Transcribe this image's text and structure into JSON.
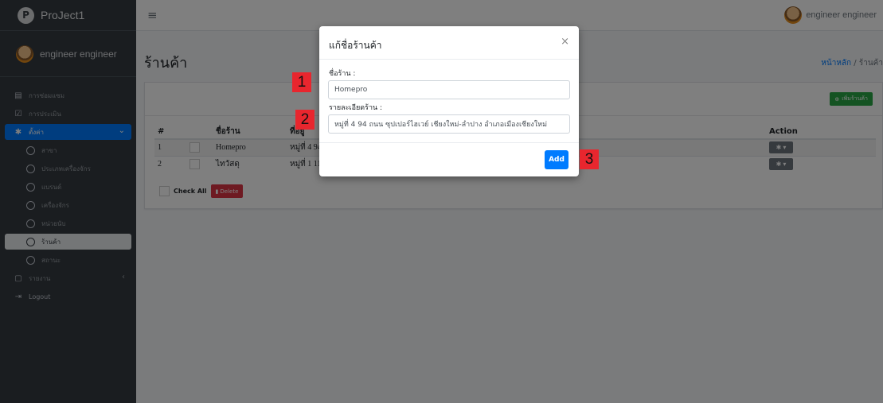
{
  "app": {
    "brand": "ProJect1",
    "brand_icon": "P"
  },
  "user": {
    "name": "engineer engineer"
  },
  "sidebar": {
    "items": [
      {
        "label": "การซ่อมแซม",
        "icon": "file-icon"
      },
      {
        "label": "การประเมิน",
        "icon": "checklist-icon"
      },
      {
        "label": "ตั้งค่า",
        "icon": "gear-icon"
      }
    ],
    "sub_items": [
      {
        "label": "สาขา"
      },
      {
        "label": "ประเภทเครื่องจักร"
      },
      {
        "label": "แบรนด์"
      },
      {
        "label": "เครื่องจักร"
      },
      {
        "label": "หน่วยนับ"
      },
      {
        "label": "ร้านค้า"
      },
      {
        "label": "สถานะ"
      }
    ],
    "report": {
      "label": "รายงาน"
    },
    "logout": {
      "label": "Logout"
    }
  },
  "header": {
    "page_title": "ร้านค้า",
    "breadcrumb_home": "หน้าหลัก",
    "breadcrumb_sep": " / ",
    "breadcrumb_current": "ร้านค้า"
  },
  "card": {
    "add_button": "เพิ่มร้านค้า",
    "columns": [
      "#",
      "ชื่อร้าน",
      "ที่อยู่",
      "Action"
    ],
    "rows": [
      {
        "num": "1",
        "name": "Homepro",
        "addr": "หมู่ที่ 4 94 ถ"
      },
      {
        "num": "2",
        "name": "ไทวัสดุ",
        "addr": "หมู่ที่ 1 111"
      }
    ],
    "check_all": "Check All",
    "delete": "Delete"
  },
  "modal": {
    "title": "แก้ชื่อร้านค้า",
    "close": "×",
    "name_label": "ชื่อร้าน :",
    "name_value": "Homepro",
    "detail_label": "รายละเอียดร้าน :",
    "detail_value": "หมู่ที่ 4 94 ถนน ซุปเปอร์ไฮเวย์ เชียงใหม่-ลำปาง อำเภอเมืองเชียงใหม่",
    "add_button": "Add"
  },
  "markers": [
    "1",
    "2",
    "3"
  ],
  "colors": {
    "sidebar": "#343a40",
    "primary": "#007bff",
    "success": "#28a745",
    "danger": "#dc3545",
    "marker": "#e8262e"
  }
}
